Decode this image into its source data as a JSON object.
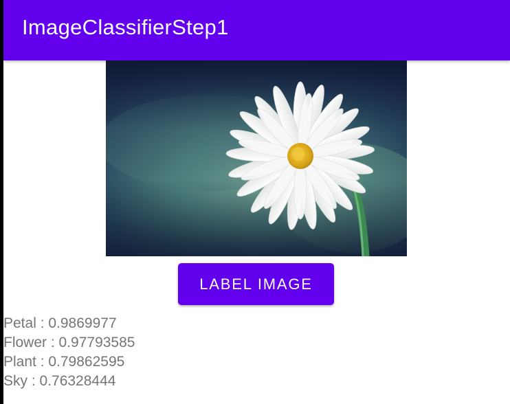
{
  "app_bar": {
    "title": "ImageClassifierStep1",
    "color": "#6200EE"
  },
  "image": {
    "subject": "white daisy flower on blurred teal-green background",
    "icon": "daisy-photo"
  },
  "button": {
    "label": "LABEL IMAGE",
    "color": "#6200EE"
  },
  "results": [
    "Petal : 0.9869977",
    "Flower : 0.97793585",
    "Plant : 0.79862595",
    "Sky : 0.76328444"
  ],
  "colors": {
    "result_text": "#757575"
  }
}
